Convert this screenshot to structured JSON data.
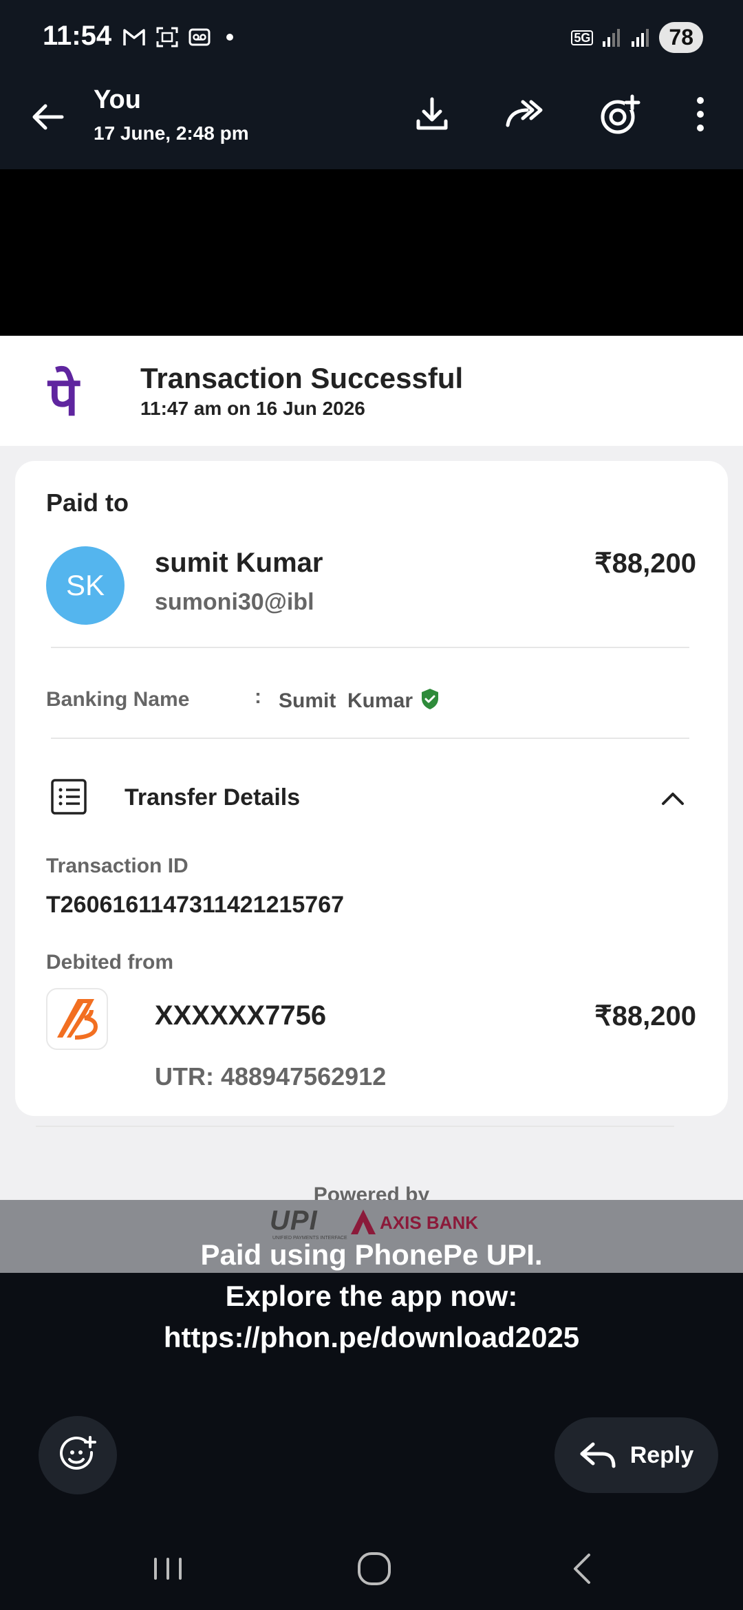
{
  "status_bar": {
    "time": "11:54",
    "battery": "78",
    "network": "5G",
    "left_icons": [
      "gmail-icon",
      "screenshot-icon",
      "voicemail-icon",
      "dot-icon"
    ],
    "right_icons": [
      "5g-icon",
      "signal-icon",
      "signal-icon",
      "battery-icon"
    ]
  },
  "header": {
    "sender": "You",
    "datetime": "17 June, 2:48 pm",
    "actions": [
      "download-icon",
      "forward-icon",
      "share-icon",
      "more-icon"
    ]
  },
  "receipt": {
    "status": "Transaction Successful",
    "time": "11:47 am on 16 Jun 2026",
    "logo_glyph": "पे",
    "paid_to_label": "Paid to",
    "avatar_initials": "SK",
    "payee_name": "sumit Kumar",
    "payee_vpa": "sumoni30@ibl",
    "amount": "₹88,200",
    "banking_name_label": "Banking Name",
    "banking_name_sep": ":",
    "banking_name_value": "Sumit  Kumar",
    "transfer_details_label": "Transfer Details",
    "transaction_id_label": "Transaction ID",
    "transaction_id": "T2606161147311421215767",
    "debited_from_label": "Debited from",
    "account": "XXXXXX7756",
    "account_amount": "₹88,200",
    "utr": "UTR: 488947562912",
    "powered_by": "Powered by"
  },
  "caption": {
    "upi_text": "UPI",
    "upi_subtext": "UNIFIED PAYMENTS INTERFACE",
    "axis_text": "AXIS BANK",
    "line1": "Paid using PhonePe UPI.",
    "line2": "Explore the app now:",
    "line3": "https://phon.pe/download2025"
  },
  "bottom": {
    "reply_label": "Reply"
  },
  "colors": {
    "phonepe_purple": "#5f259f",
    "avatar_blue": "#54b5ee",
    "verified_green": "#2e8b3a",
    "axis_maroon": "#8b1a3a"
  }
}
